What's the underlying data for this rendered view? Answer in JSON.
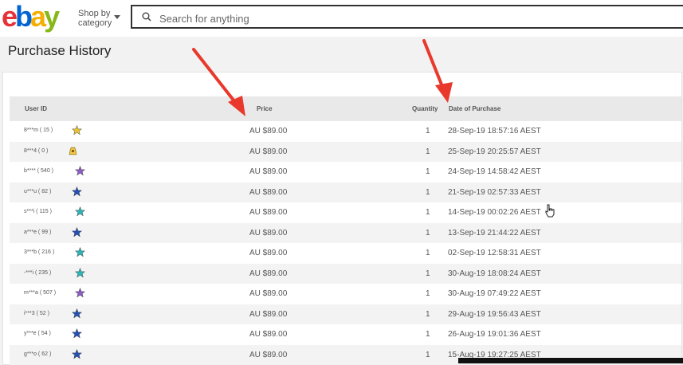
{
  "header": {
    "logo_letters": [
      "e",
      "b",
      "a",
      "y"
    ],
    "logo_colors": [
      "#e53238",
      "#0064d2",
      "#f5af02",
      "#86b817"
    ],
    "shop_by_line1": "Shop by",
    "shop_by_line2": "category",
    "search_placeholder": "Search for anything"
  },
  "page": {
    "title": "Purchase History"
  },
  "table": {
    "columns": [
      "User ID",
      "Price",
      "Quantity",
      "Date of Purchase"
    ],
    "rows": [
      {
        "user": "8***m",
        "score": "15",
        "star": "yellow-star-icon",
        "price": "AU $89.00",
        "qty": "1",
        "date": "28-Sep-19 18:57:16 AEST"
      },
      {
        "user": "8***4",
        "score": "0",
        "star": "new-user-icon",
        "price": "AU $89.00",
        "qty": "1",
        "date": "25-Sep-19 20:25:57 AEST"
      },
      {
        "user": "b****",
        "score": "540",
        "star": "purple-star-icon",
        "price": "AU $89.00",
        "qty": "1",
        "date": "24-Sep-19 14:58:42 AEST"
      },
      {
        "user": "u***u",
        "score": "82",
        "star": "blue-star-icon",
        "price": "AU $89.00",
        "qty": "1",
        "date": "21-Sep-19 02:57:33 AEST"
      },
      {
        "user": "s***i",
        "score": "115",
        "star": "turquoise-star-icon",
        "price": "AU $89.00",
        "qty": "1",
        "date": "14-Sep-19 00:02:26 AEST"
      },
      {
        "user": "a***e",
        "score": "99",
        "star": "blue-star-icon",
        "price": "AU $89.00",
        "qty": "1",
        "date": "13-Sep-19 21:44:22 AEST"
      },
      {
        "user": "3***b",
        "score": "216",
        "star": "turquoise-star-icon",
        "price": "AU $89.00",
        "qty": "1",
        "date": "02-Sep-19 12:58:31 AEST"
      },
      {
        "user": "-***i",
        "score": "235",
        "star": "turquoise-star-icon",
        "price": "AU $89.00",
        "qty": "1",
        "date": "30-Aug-19 18:08:24 AEST"
      },
      {
        "user": "m***a",
        "score": "507",
        "star": "purple-star-icon",
        "price": "AU $89.00",
        "qty": "1",
        "date": "30-Aug-19 07:49:22 AEST"
      },
      {
        "user": "i***3",
        "score": "52",
        "star": "blue-star-icon",
        "price": "AU $89.00",
        "qty": "1",
        "date": "29-Aug-19 19:56:43 AEST"
      },
      {
        "user": "y***e",
        "score": "54",
        "star": "blue-star-icon",
        "price": "AU $89.00",
        "qty": "1",
        "date": "26-Aug-19 19:01:36 AEST"
      },
      {
        "user": "g***o",
        "score": "62",
        "star": "blue-star-icon",
        "price": "AU $89.00",
        "qty": "1",
        "date": "15-Aug-19 19:27:25 AEST"
      }
    ]
  },
  "colors": {
    "arrow": "#e8392c",
    "star_yellow": "#e8c234",
    "star_blue": "#2452b3",
    "star_turquoise": "#2fb3b5",
    "star_purple": "#8c5cc4"
  }
}
